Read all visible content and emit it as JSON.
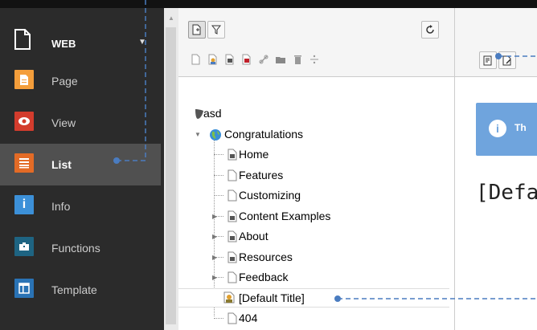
{
  "modules": {
    "group_label": "WEB",
    "items": [
      {
        "label": "Page",
        "icon": "page-module-icon",
        "color": "#f49e3b"
      },
      {
        "label": "View",
        "icon": "view-eye-icon",
        "color": "#d33c2d"
      },
      {
        "label": "List",
        "icon": "list-module-icon",
        "color": "#e36b26",
        "active": true
      },
      {
        "label": "Info",
        "icon": "info-module-icon",
        "color": "#3c90d8"
      },
      {
        "label": "Functions",
        "icon": "functions-module-icon",
        "color": "#1e6482"
      },
      {
        "label": "Template",
        "icon": "template-module-icon",
        "color": "#2a73b5"
      }
    ]
  },
  "tree": {
    "root": "asd",
    "site": "Congratulations",
    "pages": [
      "Home",
      "Features",
      "Customizing",
      "Content Examples",
      "About",
      "Resources",
      "Feedback",
      "[Default Title]",
      "404"
    ]
  },
  "content": {
    "info_title": "Th",
    "heading": "[Defau"
  },
  "colors": {
    "annotation": "#4a7cc0",
    "accent_active": "#505050"
  }
}
